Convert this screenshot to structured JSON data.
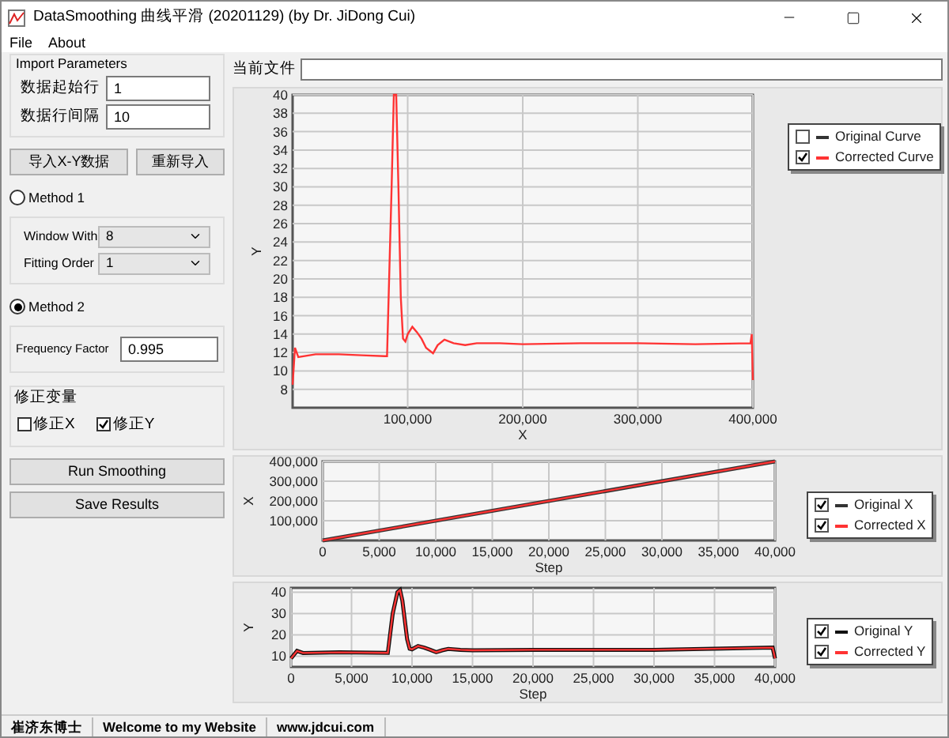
{
  "window": {
    "title": "DataSmoothing 曲线平滑 (20201129) (by Dr. JiDong Cui)"
  },
  "menu": [
    "File",
    "About"
  ],
  "import_parameters": {
    "title": "Import Parameters",
    "fields": [
      {
        "label": "数据起始行",
        "value": "1"
      },
      {
        "label": "数据行间隔",
        "value": "10"
      }
    ]
  },
  "import_buttons": [
    "导入X-Y数据",
    "重新导入"
  ],
  "method1": {
    "label": "Method 1",
    "selected": false,
    "fields": [
      {
        "label": "Window With",
        "value": "8"
      },
      {
        "label": "Fitting Order",
        "value": "1"
      }
    ]
  },
  "method2": {
    "label": "Method 2",
    "selected": true,
    "field": {
      "label": "Frequency Factor",
      "value": "0.995"
    }
  },
  "correction": {
    "title": "修正变量",
    "options": [
      {
        "label": "修正X",
        "checked": false
      },
      {
        "label": "修正Y",
        "checked": true
      }
    ]
  },
  "action_buttons": [
    "Run Smoothing",
    "Save Results"
  ],
  "current_file": {
    "label": "当前文件"
  },
  "charts": [
    {
      "legend": [
        {
          "checked": false
        },
        {
          "checked": true
        }
      ],
      "chart_data": {
        "type": "line",
        "xlabel": "X",
        "ylabel": "Y",
        "xlim": [
          0,
          400000
        ],
        "ylim": [
          6,
          40
        ],
        "grid": true,
        "x": [
          0,
          2000,
          5000,
          20000,
          40000,
          60000,
          80000,
          82000,
          86000,
          88000,
          90000,
          92000,
          94000,
          96000,
          98000,
          100000,
          104000,
          108000,
          112000,
          116000,
          122000,
          126000,
          132000,
          140000,
          150000,
          160000,
          180000,
          200000,
          250000,
          300000,
          350000,
          398000,
          399000,
          400000
        ],
        "series": [
          {
            "name": "Original Curve",
            "color": "#333333",
            "values": [
              null,
              null,
              null,
              null,
              null,
              null,
              null,
              null,
              null,
              null,
              null,
              null,
              null,
              null,
              null,
              null,
              null,
              null,
              null,
              null,
              null,
              null,
              null,
              null,
              null,
              null,
              null,
              null,
              null,
              null,
              null,
              null,
              null,
              null
            ]
          },
          {
            "name": "Corrected Curve",
            "color": "#ff3333",
            "values": [
              8.5,
              12.5,
              11.5,
              11.8,
              11.8,
              11.7,
              11.6,
              11.6,
              30,
              40,
              40,
              30,
              18,
              13.5,
              13.2,
              14,
              14.8,
              14.2,
              13.5,
              12.5,
              11.9,
              12.8,
              13.4,
              13,
              12.8,
              13,
              13,
              12.9,
              13,
              13,
              12.9,
              13,
              14,
              9
            ]
          }
        ],
        "xticks": [
          {
            "value": 100000,
            "label": "100,000"
          },
          {
            "value": 200000,
            "label": "200,000"
          },
          {
            "value": 300000,
            "label": "300,000"
          },
          {
            "value": 400000,
            "label": "400,000"
          }
        ],
        "yticks": [
          8,
          10,
          12,
          14,
          16,
          18,
          20,
          22,
          24,
          26,
          28,
          30,
          32,
          34,
          36,
          38,
          40
        ]
      }
    },
    {
      "legend": [
        {
          "checked": true
        },
        {
          "checked": true
        }
      ],
      "chart_data": {
        "type": "line",
        "xlabel": "Step",
        "ylabel": "X",
        "xlim": [
          0,
          40000
        ],
        "ylim": [
          0,
          400000
        ],
        "grid": true,
        "x": [
          0,
          40000
        ],
        "series": [
          {
            "name": "Original X",
            "color": "#333333",
            "values": [
              0,
              400000
            ]
          },
          {
            "name": "Corrected X",
            "color": "#ff3333",
            "values": [
              0,
              400000
            ]
          }
        ],
        "xticks": [
          {
            "value": 0,
            "label": "0"
          },
          {
            "value": 5000,
            "label": "5,000"
          },
          {
            "value": 10000,
            "label": "10,000"
          },
          {
            "value": 15000,
            "label": "15,000"
          },
          {
            "value": 20000,
            "label": "20,000"
          },
          {
            "value": 25000,
            "label": "25,000"
          },
          {
            "value": 30000,
            "label": "30,000"
          },
          {
            "value": 35000,
            "label": "35,000"
          },
          {
            "value": 40000,
            "label": "40,000"
          }
        ],
        "yticks": [
          {
            "value": 100000,
            "label": "100,000"
          },
          {
            "value": 200000,
            "label": "200,000"
          },
          {
            "value": 300000,
            "label": "300,000"
          },
          {
            "value": 400000,
            "label": "400,000"
          }
        ]
      }
    },
    {
      "legend": [
        {
          "checked": true
        },
        {
          "checked": true
        }
      ],
      "chart_data": {
        "type": "line",
        "xlabel": "Step",
        "ylabel": "Y",
        "xlim": [
          0,
          40000
        ],
        "ylim": [
          5,
          42
        ],
        "grid": true,
        "x": [
          0,
          500,
          1000,
          4000,
          8000,
          8400,
          8800,
          9000,
          9200,
          9600,
          9800,
          10000,
          10500,
          11000,
          11500,
          12000,
          12500,
          13000,
          14000,
          15000,
          20000,
          30000,
          39800,
          40000
        ],
        "series": [
          {
            "name": "Original Y",
            "color": "#111111",
            "values": [
              9,
              12.5,
              11.5,
              11.8,
              11.6,
              30,
              40,
              41,
              36,
              18,
              13.5,
              13.2,
              14.8,
              14,
              13,
              11.9,
              12.8,
              13.4,
              13,
              12.8,
              13,
              13,
              14,
              9
            ]
          },
          {
            "name": "Corrected Y",
            "color": "#ff3333",
            "values": [
              9,
              12.5,
              11.5,
              11.8,
              11.6,
              30,
              40,
              41,
              36,
              18,
              13.5,
              13.2,
              14.8,
              14,
              13,
              11.9,
              12.8,
              13.4,
              13,
              12.8,
              13,
              13,
              14,
              9
            ]
          }
        ],
        "xticks": [
          {
            "value": 0,
            "label": "0"
          },
          {
            "value": 5000,
            "label": "5,000"
          },
          {
            "value": 10000,
            "label": "10,000"
          },
          {
            "value": 15000,
            "label": "15,000"
          },
          {
            "value": 20000,
            "label": "20,000"
          },
          {
            "value": 25000,
            "label": "25,000"
          },
          {
            "value": 30000,
            "label": "30,000"
          },
          {
            "value": 35000,
            "label": "35,000"
          },
          {
            "value": 40000,
            "label": "40,000"
          }
        ],
        "yticks": [
          10,
          20,
          30,
          40
        ]
      }
    }
  ],
  "status_bar": [
    "崔济东博士",
    "Welcome to my Website",
    "www.jdcui.com"
  ]
}
